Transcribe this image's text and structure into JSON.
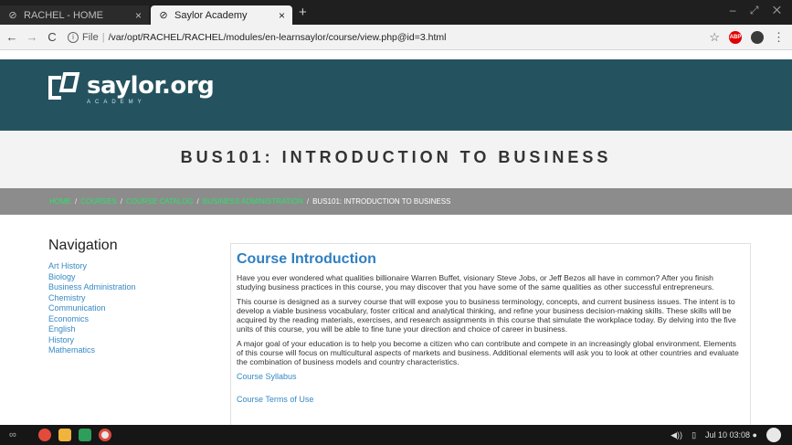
{
  "browser": {
    "tabs": [
      {
        "title": "RACHEL - HOME",
        "active": false
      },
      {
        "title": "Saylor Academy",
        "active": true
      }
    ],
    "new_tab": "+",
    "window_controls": "– ⤢ ✕",
    "url_prefix": "File",
    "url": "/var/opt/RACHEL/RACHEL/modules/en-learnsaylor/course/view.php@id=3.html"
  },
  "site": {
    "logo": "saylor.org",
    "logo_sub": "ACADEMY",
    "course_title": "BUS101: INTRODUCTION TO BUSINESS",
    "breadcrumb": [
      "HOME",
      "COURSES",
      "COURSE CATALOG",
      "BUSINESS ADMINISTRATION",
      "BUS101: INTRODUCTION TO BUSINESS"
    ],
    "breadcrumb_sep": "/"
  },
  "navigation": {
    "heading": "Navigation",
    "items": [
      "Art History",
      "Biology",
      "Business Administration",
      "Chemistry",
      "Communication",
      "Economics",
      "English",
      "History",
      "Mathematics"
    ]
  },
  "main": {
    "heading": "Course Introduction",
    "paragraphs": [
      "Have you ever wondered what qualities billionaire Warren Buffet, visionary Steve Jobs, or Jeff Bezos all have in common? After you finish studying business practices in this course, you may discover that you have some of the same qualities as other successful entrepreneurs.",
      "This course is designed as a survey course that will expose you to business terminology, concepts, and current business issues. The intent is to develop a viable business vocabulary, foster critical and analytical thinking, and refine your business decision-making skills. These skills will be acquired by the reading materials, exercises, and research assignments in this course that simulate the workplace today. By delving into the five units of this course, you will be able to fine tune your direction and choice of career in business.",
      "A major goal of your education is to help you become a citizen who can contribute and compete in an increasingly global environment. Elements of this course will focus on multicultural aspects of markets and business. Additional elements will ask you to look at other countries and evaluate the combination of business models and country characteristics."
    ],
    "links": [
      "Course Syllabus",
      "Course Terms of Use"
    ]
  },
  "taskbar": {
    "clock": "Jul 10  03:08 ●"
  },
  "colors": {
    "header": "#24535f",
    "breadcrumb_link": "#2ee06b",
    "link": "#3689c4"
  }
}
